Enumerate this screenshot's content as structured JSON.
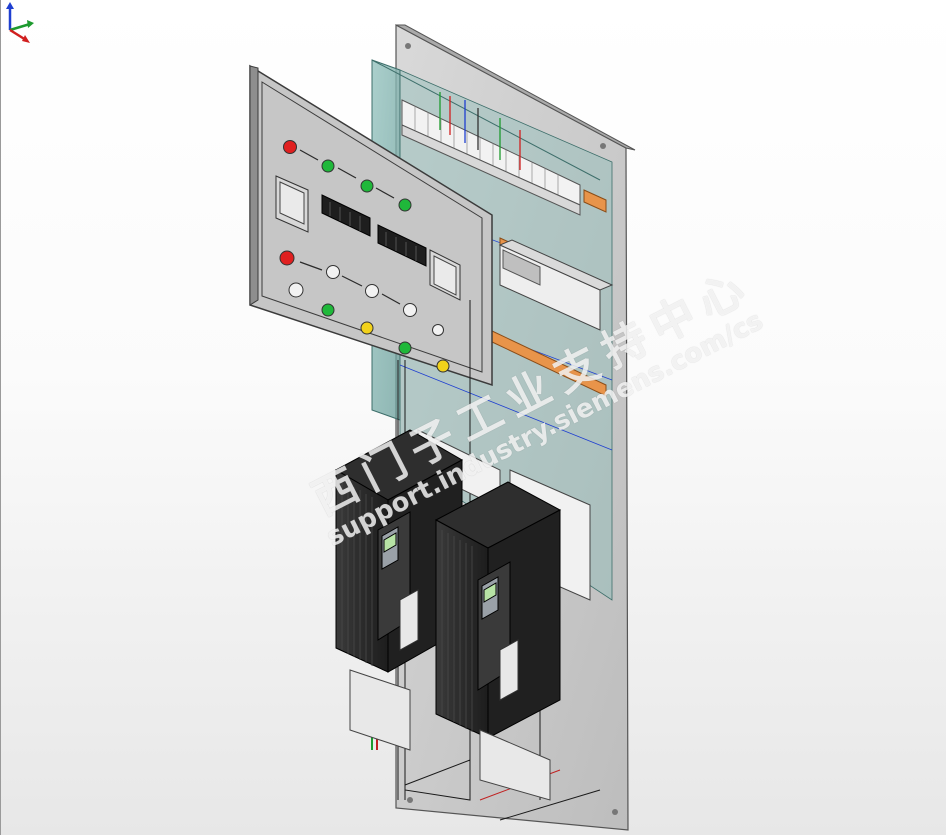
{
  "viewer": {
    "background_top": "#ffffff",
    "background_bottom": "#e7e7e7",
    "axes_icon": "xyz-triad-icon",
    "axes_colors": {
      "x": "#d11f1f",
      "y": "#1d9a2e",
      "z": "#1f3fd1"
    }
  },
  "model": {
    "components": [
      "enclosure-back-panel",
      "hinged-door-panel",
      "pushbutton-red",
      "pushbutton-green",
      "pilot-light-yellow",
      "selector-switch",
      "panel-meter",
      "terminal-blocks",
      "cable-duct-orange",
      "din-rail",
      "variable-frequency-drive",
      "drive-operator-panel"
    ],
    "colors": {
      "panel": "#cfcfcf",
      "glass": "#7fb1ad",
      "drive_body": "#2a2a2a",
      "drive_face": "#9aa1a8",
      "duct": "#e8944a",
      "button_red": "#e02020",
      "button_green": "#1fb83a",
      "light_yellow": "#f2d21b"
    }
  },
  "watermark": {
    "line1": "西门子工业支持中心",
    "line2": "support.industry.siemens.com/cs"
  }
}
